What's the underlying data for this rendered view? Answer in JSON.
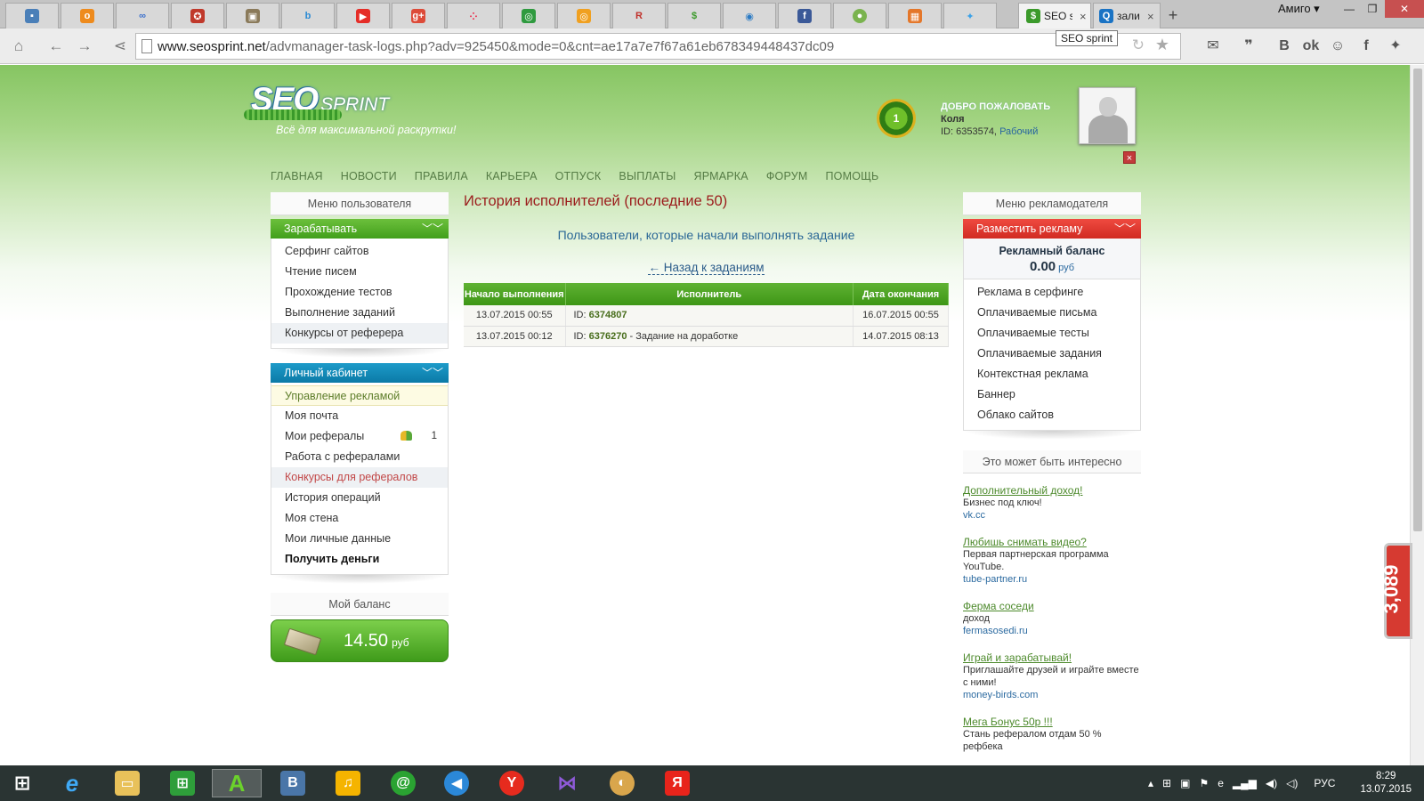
{
  "browser": {
    "app_name": "Амиго",
    "active_tab_title": "SEO s",
    "second_tab_title": "зали",
    "tooltip": "SEO sprint",
    "url_host": "www.seosprint.net",
    "url_path": "/advmanager-task-logs.php?adv=925450&mode=0&cnt=ae17a7e7f67a61eb678349448437dc09"
  },
  "site": {
    "logo_seo": "SEO",
    "logo_sprint": "SPRINT",
    "tagline": "Всё для максимальной раскрутки!",
    "rank": "1",
    "welcome_title": "ДОБРО ПОЖАЛОВАТЬ",
    "user_name": "Коля",
    "user_id": "ID: 6353574,",
    "user_status": "Рабочий",
    "nav": [
      "ГЛАВНАЯ",
      "НОВОСТИ",
      "ПРАВИЛА",
      "КАРЬЕРА",
      "ОТПУСК",
      "ВЫПЛАТЫ",
      "ЯРМАРКА",
      "ФОРУМ",
      "ПОМОЩЬ"
    ]
  },
  "left": {
    "user_menu_title": "Меню пользователя",
    "earn_title": "Зарабатывать",
    "earn_items": [
      "Серфинг сайтов",
      "Чтение писем",
      "Прохождение тестов",
      "Выполнение заданий",
      "Конкурсы от реферера"
    ],
    "cabinet_title": "Личный кабинет",
    "cabinet_items": [
      "Управление рекламой",
      "Моя почта",
      "Мои рефералы",
      "Работа с рефералами",
      "Конкурсы для рефералов",
      "История операций",
      "Моя стена",
      "Мои личные данные",
      "Получить деньги"
    ],
    "referrals_count": "1",
    "balance_title": "Мой баланс",
    "balance_value": "14.50",
    "balance_currency": "руб"
  },
  "main": {
    "title": "История исполнителей (последние 50)",
    "subtitle": "Пользователи, которые начали выполнять задание",
    "back_link": "← Назад к заданиям",
    "columns": [
      "Начало выполнения",
      "Исполнитель",
      "Дата окончания"
    ],
    "rows": [
      {
        "start": "13.07.2015 00:55",
        "id_label": "ID:",
        "id": "6374807",
        "status": "",
        "end": "16.07.2015 00:55"
      },
      {
        "start": "13.07.2015 00:12",
        "id_label": "ID:",
        "id": "6376270",
        "status": "- Задание на доработке",
        "end": "14.07.2015 08:13"
      }
    ]
  },
  "right": {
    "adv_menu_title": "Меню рекламодателя",
    "place_ad": "Разместить рекламу",
    "ad_balance_title": "Рекламный баланс",
    "ad_balance_value": "0.00",
    "ad_balance_currency": "руб",
    "items": [
      "Реклама в серфинге",
      "Оплачиваемые письма",
      "Оплачиваемые тесты",
      "Оплачиваемые задания",
      "Контекстная реклама",
      "Баннер",
      "Облако сайтов"
    ],
    "interest_title": "Это может быть интересно",
    "ads": [
      {
        "title": "Дополнительный доход!",
        "desc": "Бизнес под ключ!",
        "url": "vk.cc"
      },
      {
        "title": "Любишь снимать видео?",
        "desc": "Первая партнерская программа YouTube.",
        "url": "tube-partner.ru"
      },
      {
        "title": "Ферма соседи",
        "desc": "доход",
        "url": "fermasosedi.ru"
      },
      {
        "title": "Играй и зарабатывай!",
        "desc": "Приглашайте друзей и играйте вместе с ними!",
        "url": "money-birds.com"
      },
      {
        "title": "Мега Бонус 50р !!!",
        "desc": "Стань рефералом отдам 50 % рефбека",
        "url": ""
      }
    ]
  },
  "widget": {
    "value": "3,089"
  },
  "taskbar": {
    "lang": "РУС",
    "time": "8:29",
    "date": "13.07.2015"
  }
}
